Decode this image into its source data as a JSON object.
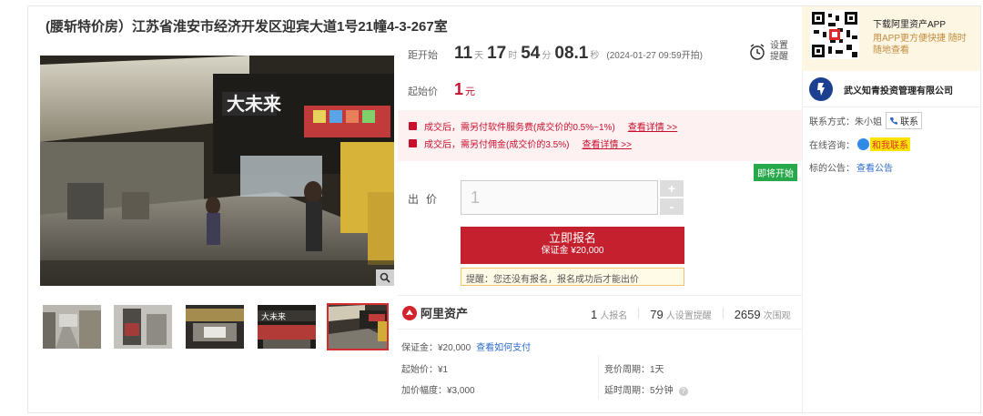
{
  "title": "(腰斩特价房）江苏省淮安市经济开发区迎宾大道1号21幢4-3-267室",
  "countdown": {
    "label": "距开始",
    "days": "11",
    "days_unit": "天",
    "hours": "17",
    "hours_unit": "时",
    "minutes": "54",
    "minutes_unit": "分",
    "seconds": "08.1",
    "seconds_unit": "秒",
    "start_time": "(2024-01-27 09:59开拍)",
    "remind_label": "设置提醒"
  },
  "start_price": {
    "label": "起始价",
    "value": "1",
    "unit": "元"
  },
  "notices": [
    {
      "text": "成交后，需另付软件服务费(成交价的0.5%~1%)",
      "link": "查看详情 >>"
    },
    {
      "text": "成交后，需另付佣金(成交价的3.5%)",
      "link": "查看详情 >>"
    }
  ],
  "status_badge": "即将开始",
  "bid": {
    "label": "出价",
    "value": "1",
    "plus": "+",
    "minus": "-",
    "signup_label": "立即报名",
    "signup_deposit": "保证金 ¥20,000",
    "hint": "提醒：您还没有报名，报名成功后才能出价"
  },
  "brand": {
    "name": "阿里资产"
  },
  "stats": [
    {
      "num": "1",
      "label": "人报名"
    },
    {
      "num": "79",
      "label": "人设置提醒"
    },
    {
      "num": "2659",
      "label": "次围观"
    }
  ],
  "details": {
    "deposit": "保证金：¥20,000",
    "pay_link": "查看如何支付",
    "start_price": "起始价：¥1",
    "increment": "加价幅度：¥3,000",
    "cycle": "竞价周期：1天",
    "delay": "延时周期：5分钟"
  },
  "app": {
    "title": "下载阿里资产APP",
    "desc": "用APP更方便快捷 随时随地查看"
  },
  "org": {
    "name": "武义知青投资管理有限公司"
  },
  "contact": {
    "label": "联系方式：朱小姐",
    "button": "联系"
  },
  "consult": {
    "label": "在线咨询：",
    "button": "和我联系"
  },
  "announce": {
    "label": "标的公告：",
    "link": "查看公告"
  },
  "colors": {
    "accent": "#c4202e",
    "link": "#2d6acb",
    "badge": "#27a84a"
  }
}
